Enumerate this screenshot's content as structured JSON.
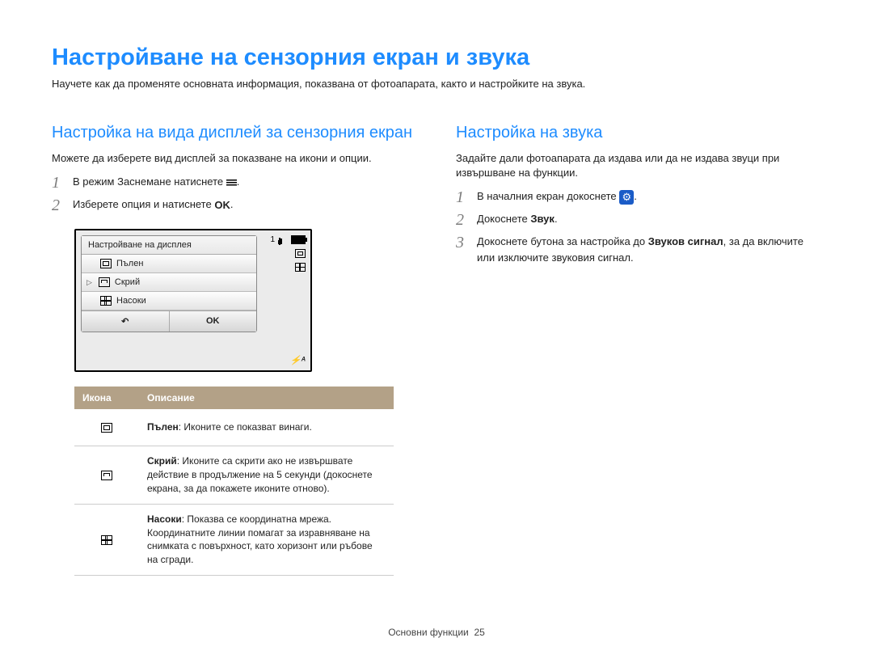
{
  "page_title": "Настройване на сензорния екран и звука",
  "page_sub": "Научете как да променяте основната информация, показвана от фотоапарата, както и настройките на звука.",
  "left": {
    "heading": "Настройка на вида дисплей за сензорния екран",
    "intro": "Можете да изберете вид дисплей за показване на икони и опции.",
    "steps": [
      {
        "num": "1",
        "pre": "В режим Заснемане натиснете ",
        "icon": "menu",
        "post": "."
      },
      {
        "num": "2",
        "pre": "Изберете опция и натиснете ",
        "icon": "ok",
        "post": "."
      }
    ]
  },
  "screenshot": {
    "title": "Настройване на дисплея",
    "items": [
      "Пълен",
      "Скрий",
      "Насоки"
    ],
    "selected_index": 1,
    "back_label": "↶",
    "ok_label": "OK",
    "counter": "1",
    "flash_label": "⚡ᴬ"
  },
  "table": {
    "headers": [
      "Икона",
      "Описание"
    ],
    "rows": [
      {
        "icon": "full",
        "bold": "Пълен",
        "desc": ": Иконите се показват винаги."
      },
      {
        "icon": "hide",
        "bold": "Скрий",
        "desc": ": Иконите са скрити ако не извършвате действие в продължение на 5 секунди (докоснете екрана, за да покажете иконите отново)."
      },
      {
        "icon": "grid",
        "bold": "Насоки",
        "desc": ": Показва се координатна мрежа. Координатните линии помагат за изравняване на снимката с повърхност, като хоризонт или ръбове на сгради."
      }
    ]
  },
  "right": {
    "heading": "Настройка на звука",
    "intro": "Задайте дали фотоапарата да издава или да не издава звуци при извършване на функции.",
    "steps": [
      {
        "num": "1",
        "pre": "В началния екран докоснете ",
        "icon": "gear",
        "post": "."
      },
      {
        "num": "2",
        "pre": "Докоснете ",
        "bold": "Звук",
        "post": "."
      },
      {
        "num": "3",
        "pre": "Докоснете бутона за настройка до ",
        "bold": "Звуков сигнал",
        "post": ", за да включите или изключите звуковия сигнал."
      }
    ]
  },
  "footer": {
    "section": "Основни функции",
    "page": "25"
  }
}
